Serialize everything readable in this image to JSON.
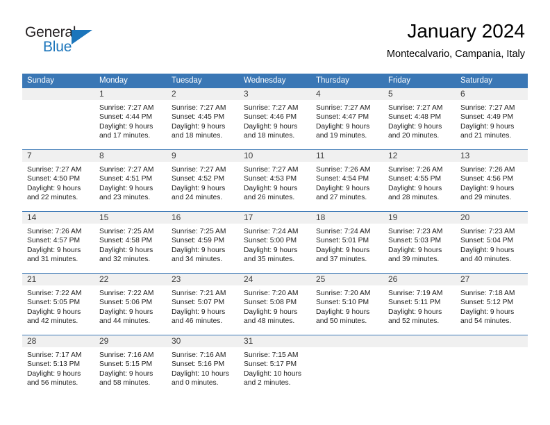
{
  "brand": {
    "name_part1": "General",
    "name_part2": "Blue",
    "accent_color": "#1b75bb"
  },
  "header": {
    "title": "January 2024",
    "subtitle": "Montecalvario, Campania, Italy"
  },
  "calendar": {
    "header_bg": "#3a77b5",
    "daynum_bg": "#f0f0f0",
    "weekday_headers": [
      "Sunday",
      "Monday",
      "Tuesday",
      "Wednesday",
      "Thursday",
      "Friday",
      "Saturday"
    ],
    "weeks": [
      [
        {
          "day": "",
          "sunrise": "",
          "sunset": "",
          "daylight1": "",
          "daylight2": ""
        },
        {
          "day": "1",
          "sunrise": "Sunrise: 7:27 AM",
          "sunset": "Sunset: 4:44 PM",
          "daylight1": "Daylight: 9 hours",
          "daylight2": "and 17 minutes."
        },
        {
          "day": "2",
          "sunrise": "Sunrise: 7:27 AM",
          "sunset": "Sunset: 4:45 PM",
          "daylight1": "Daylight: 9 hours",
          "daylight2": "and 18 minutes."
        },
        {
          "day": "3",
          "sunrise": "Sunrise: 7:27 AM",
          "sunset": "Sunset: 4:46 PM",
          "daylight1": "Daylight: 9 hours",
          "daylight2": "and 18 minutes."
        },
        {
          "day": "4",
          "sunrise": "Sunrise: 7:27 AM",
          "sunset": "Sunset: 4:47 PM",
          "daylight1": "Daylight: 9 hours",
          "daylight2": "and 19 minutes."
        },
        {
          "day": "5",
          "sunrise": "Sunrise: 7:27 AM",
          "sunset": "Sunset: 4:48 PM",
          "daylight1": "Daylight: 9 hours",
          "daylight2": "and 20 minutes."
        },
        {
          "day": "6",
          "sunrise": "Sunrise: 7:27 AM",
          "sunset": "Sunset: 4:49 PM",
          "daylight1": "Daylight: 9 hours",
          "daylight2": "and 21 minutes."
        }
      ],
      [
        {
          "day": "7",
          "sunrise": "Sunrise: 7:27 AM",
          "sunset": "Sunset: 4:50 PM",
          "daylight1": "Daylight: 9 hours",
          "daylight2": "and 22 minutes."
        },
        {
          "day": "8",
          "sunrise": "Sunrise: 7:27 AM",
          "sunset": "Sunset: 4:51 PM",
          "daylight1": "Daylight: 9 hours",
          "daylight2": "and 23 minutes."
        },
        {
          "day": "9",
          "sunrise": "Sunrise: 7:27 AM",
          "sunset": "Sunset: 4:52 PM",
          "daylight1": "Daylight: 9 hours",
          "daylight2": "and 24 minutes."
        },
        {
          "day": "10",
          "sunrise": "Sunrise: 7:27 AM",
          "sunset": "Sunset: 4:53 PM",
          "daylight1": "Daylight: 9 hours",
          "daylight2": "and 26 minutes."
        },
        {
          "day": "11",
          "sunrise": "Sunrise: 7:26 AM",
          "sunset": "Sunset: 4:54 PM",
          "daylight1": "Daylight: 9 hours",
          "daylight2": "and 27 minutes."
        },
        {
          "day": "12",
          "sunrise": "Sunrise: 7:26 AM",
          "sunset": "Sunset: 4:55 PM",
          "daylight1": "Daylight: 9 hours",
          "daylight2": "and 28 minutes."
        },
        {
          "day": "13",
          "sunrise": "Sunrise: 7:26 AM",
          "sunset": "Sunset: 4:56 PM",
          "daylight1": "Daylight: 9 hours",
          "daylight2": "and 29 minutes."
        }
      ],
      [
        {
          "day": "14",
          "sunrise": "Sunrise: 7:26 AM",
          "sunset": "Sunset: 4:57 PM",
          "daylight1": "Daylight: 9 hours",
          "daylight2": "and 31 minutes."
        },
        {
          "day": "15",
          "sunrise": "Sunrise: 7:25 AM",
          "sunset": "Sunset: 4:58 PM",
          "daylight1": "Daylight: 9 hours",
          "daylight2": "and 32 minutes."
        },
        {
          "day": "16",
          "sunrise": "Sunrise: 7:25 AM",
          "sunset": "Sunset: 4:59 PM",
          "daylight1": "Daylight: 9 hours",
          "daylight2": "and 34 minutes."
        },
        {
          "day": "17",
          "sunrise": "Sunrise: 7:24 AM",
          "sunset": "Sunset: 5:00 PM",
          "daylight1": "Daylight: 9 hours",
          "daylight2": "and 35 minutes."
        },
        {
          "day": "18",
          "sunrise": "Sunrise: 7:24 AM",
          "sunset": "Sunset: 5:01 PM",
          "daylight1": "Daylight: 9 hours",
          "daylight2": "and 37 minutes."
        },
        {
          "day": "19",
          "sunrise": "Sunrise: 7:23 AM",
          "sunset": "Sunset: 5:03 PM",
          "daylight1": "Daylight: 9 hours",
          "daylight2": "and 39 minutes."
        },
        {
          "day": "20",
          "sunrise": "Sunrise: 7:23 AM",
          "sunset": "Sunset: 5:04 PM",
          "daylight1": "Daylight: 9 hours",
          "daylight2": "and 40 minutes."
        }
      ],
      [
        {
          "day": "21",
          "sunrise": "Sunrise: 7:22 AM",
          "sunset": "Sunset: 5:05 PM",
          "daylight1": "Daylight: 9 hours",
          "daylight2": "and 42 minutes."
        },
        {
          "day": "22",
          "sunrise": "Sunrise: 7:22 AM",
          "sunset": "Sunset: 5:06 PM",
          "daylight1": "Daylight: 9 hours",
          "daylight2": "and 44 minutes."
        },
        {
          "day": "23",
          "sunrise": "Sunrise: 7:21 AM",
          "sunset": "Sunset: 5:07 PM",
          "daylight1": "Daylight: 9 hours",
          "daylight2": "and 46 minutes."
        },
        {
          "day": "24",
          "sunrise": "Sunrise: 7:20 AM",
          "sunset": "Sunset: 5:08 PM",
          "daylight1": "Daylight: 9 hours",
          "daylight2": "and 48 minutes."
        },
        {
          "day": "25",
          "sunrise": "Sunrise: 7:20 AM",
          "sunset": "Sunset: 5:10 PM",
          "daylight1": "Daylight: 9 hours",
          "daylight2": "and 50 minutes."
        },
        {
          "day": "26",
          "sunrise": "Sunrise: 7:19 AM",
          "sunset": "Sunset: 5:11 PM",
          "daylight1": "Daylight: 9 hours",
          "daylight2": "and 52 minutes."
        },
        {
          "day": "27",
          "sunrise": "Sunrise: 7:18 AM",
          "sunset": "Sunset: 5:12 PM",
          "daylight1": "Daylight: 9 hours",
          "daylight2": "and 54 minutes."
        }
      ],
      [
        {
          "day": "28",
          "sunrise": "Sunrise: 7:17 AM",
          "sunset": "Sunset: 5:13 PM",
          "daylight1": "Daylight: 9 hours",
          "daylight2": "and 56 minutes."
        },
        {
          "day": "29",
          "sunrise": "Sunrise: 7:16 AM",
          "sunset": "Sunset: 5:15 PM",
          "daylight1": "Daylight: 9 hours",
          "daylight2": "and 58 minutes."
        },
        {
          "day": "30",
          "sunrise": "Sunrise: 7:16 AM",
          "sunset": "Sunset: 5:16 PM",
          "daylight1": "Daylight: 10 hours",
          "daylight2": "and 0 minutes."
        },
        {
          "day": "31",
          "sunrise": "Sunrise: 7:15 AM",
          "sunset": "Sunset: 5:17 PM",
          "daylight1": "Daylight: 10 hours",
          "daylight2": "and 2 minutes."
        },
        {
          "day": "",
          "sunrise": "",
          "sunset": "",
          "daylight1": "",
          "daylight2": ""
        },
        {
          "day": "",
          "sunrise": "",
          "sunset": "",
          "daylight1": "",
          "daylight2": ""
        },
        {
          "day": "",
          "sunrise": "",
          "sunset": "",
          "daylight1": "",
          "daylight2": ""
        }
      ]
    ]
  }
}
